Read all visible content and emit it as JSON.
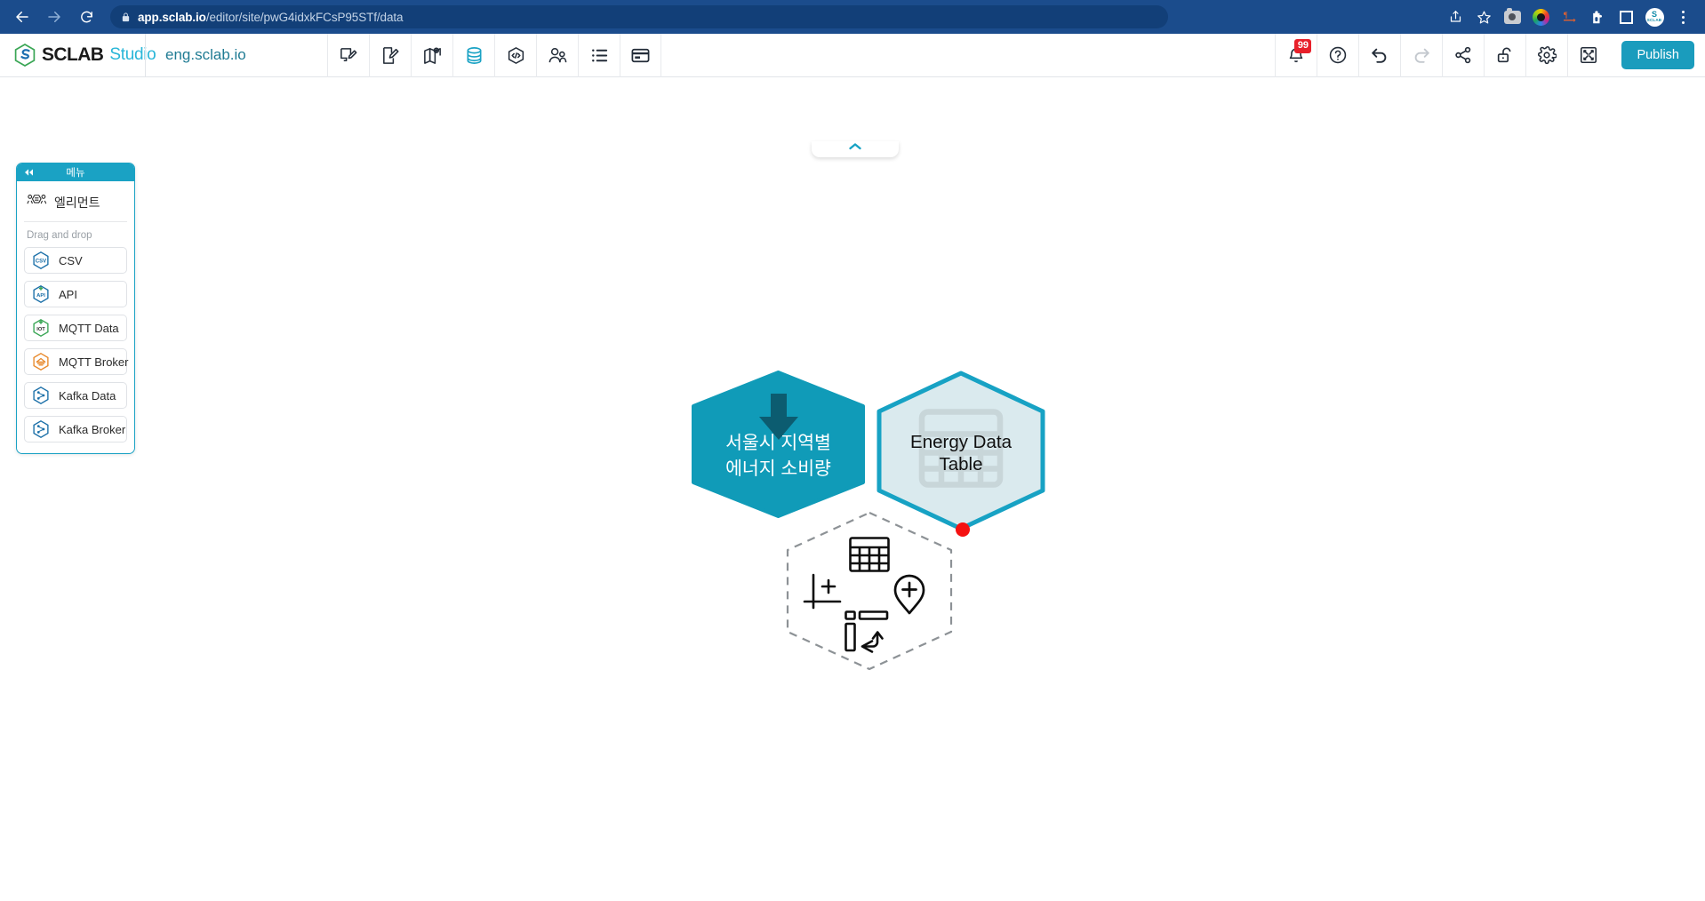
{
  "browser": {
    "back_icon": "back-arrow-icon",
    "forward_icon": "forward-arrow-icon",
    "reload_icon": "reload-icon",
    "lock_icon": "lock-icon",
    "url_host": "app.sclab.io",
    "url_path": "/editor/site/pwG4idxkFCsP95STf/data",
    "right_icons": [
      {
        "name": "share-icon"
      },
      {
        "name": "bookmark-star-icon"
      },
      {
        "name": "screenshot-extension-icon"
      },
      {
        "name": "color-picker-extension-icon"
      },
      {
        "name": "pilcrow-extension-icon"
      },
      {
        "name": "puzzle-extensions-icon"
      },
      {
        "name": "sidebar-panel-icon"
      },
      {
        "name": "sclab-profile-avatar"
      },
      {
        "name": "chrome-menu-icon"
      }
    ]
  },
  "header": {
    "logo_text": "SCLAB",
    "logo_studio": "Studio",
    "site_name": "eng.sclab.io",
    "tools": [
      {
        "name": "screen-edit-icon",
        "active": false
      },
      {
        "name": "page-edit-icon",
        "active": false
      },
      {
        "name": "map-icon",
        "active": false
      },
      {
        "name": "database-icon",
        "active": true
      },
      {
        "name": "code-hexagon-icon",
        "active": false
      },
      {
        "name": "users-icon",
        "active": false
      },
      {
        "name": "list-icon",
        "active": false
      },
      {
        "name": "card-icon",
        "active": false
      }
    ],
    "actions": [
      {
        "name": "notifications-icon",
        "badge": "99"
      },
      {
        "name": "help-icon",
        "badge": ""
      },
      {
        "name": "undo-icon",
        "badge": ""
      },
      {
        "name": "redo-icon",
        "badge": ""
      },
      {
        "name": "share-icon",
        "badge": ""
      },
      {
        "name": "unlock-icon",
        "badge": ""
      },
      {
        "name": "settings-gear-icon",
        "badge": ""
      },
      {
        "name": "fullscreen-icon",
        "badge": ""
      }
    ],
    "notification_count": "99",
    "publish_label": "Publish",
    "accent_color": "#1a9cbd"
  },
  "sidebar": {
    "menu_title": "메뉴",
    "collapse_icon": "collapse-left-icon",
    "element_label": "엘리먼트",
    "element_icon": "element-nodes-icon",
    "drag_label": "Drag and drop",
    "items": [
      {
        "label": "CSV",
        "icon": "csv-hexagon-icon",
        "color": "#1a6fa8"
      },
      {
        "label": "API",
        "icon": "api-hexagon-icon",
        "color": "#1a6fa8"
      },
      {
        "label": "MQTT Data",
        "icon": "mqtt-data-hexagon-icon",
        "color": "#3aa655"
      },
      {
        "label": "MQTT Broker",
        "icon": "mqtt-broker-hexagon-icon",
        "color": "#e8892b"
      },
      {
        "label": "Kafka Data",
        "icon": "kafka-data-hexagon-icon",
        "color": "#1a6fa8"
      },
      {
        "label": "Kafka Broker",
        "icon": "kafka-broker-hexagon-icon",
        "color": "#1a6fa8"
      }
    ]
  },
  "canvas": {
    "collapse_tab_icon": "chevron-up-icon",
    "source_node": {
      "name": "data-source-node",
      "label_line1": "서울시 지역별",
      "label_line2": "에너지 소비량",
      "icon": "download-arrow-icon",
      "fill": "#109bb8"
    },
    "table_node": {
      "name": "energy-data-table-node",
      "label_line1": "Energy Data",
      "label_line2": "Table",
      "watermark_icon": "table-grid-icon",
      "fill": "#daeaee",
      "border": "#17a2c4",
      "status_dot_color": "#f51111"
    },
    "add_node": {
      "name": "add-node-placeholder",
      "icons": [
        {
          "name": "table-icon"
        },
        {
          "name": "axis-add-icon"
        },
        {
          "name": "map-pin-add-icon"
        },
        {
          "name": "transform-pivot-icon"
        }
      ]
    }
  }
}
